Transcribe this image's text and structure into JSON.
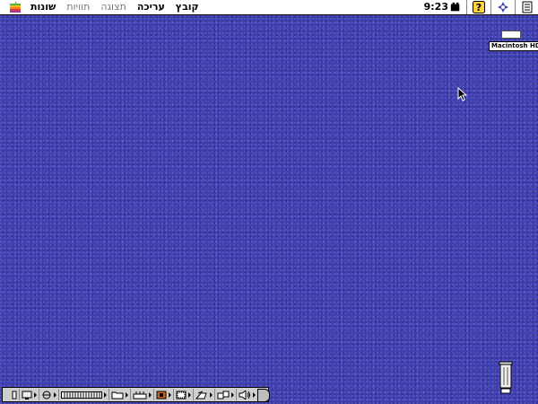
{
  "menubar": {
    "menus": [
      {
        "label": "קובץ",
        "enabled": true
      },
      {
        "label": "עריכה",
        "enabled": true
      },
      {
        "label": "תצוגה",
        "enabled": false
      },
      {
        "label": "תוויות",
        "enabled": false
      },
      {
        "label": "שונות",
        "enabled": true
      }
    ],
    "clock": "9:23",
    "icons": [
      "apple-icon",
      "battery-icon",
      "help-icon",
      "app-switcher-icon",
      "finder-icon"
    ]
  },
  "desktop": {
    "background_color": "#3f3fb3",
    "hard_disk": {
      "label": "Macintosh HD"
    },
    "trash": {
      "label": "trash-icon"
    }
  },
  "control_strip": {
    "modules": [
      "strip-collapse-icon",
      "monitor-icon",
      "appletalk-icon",
      "memory-bar-icon",
      "folder-icon",
      "keyboard-icon",
      "cd-icon",
      "monitor-bitdepth-icon",
      "printer-icon",
      "file-sharing-icon",
      "speaker-icon"
    ]
  }
}
